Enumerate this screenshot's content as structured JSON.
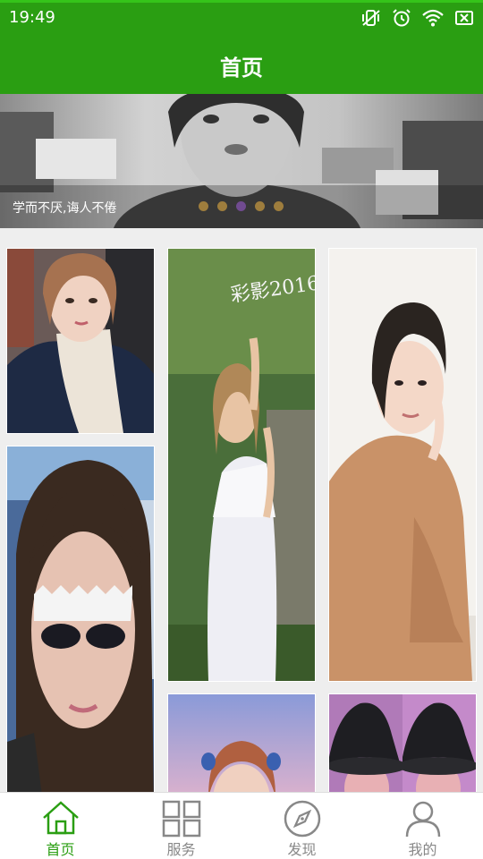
{
  "status_bar": {
    "time": "19:49",
    "icons": [
      "vibrate-off-icon",
      "alarm-icon",
      "wifi-icon",
      "no-sim-icon"
    ]
  },
  "app_bar": {
    "title": "首页"
  },
  "banner": {
    "caption": "学而不厌,诲人不倦",
    "page_count": 5,
    "active_index": 2
  },
  "grid": {
    "images": [
      {
        "description": "photo-girl-scarf"
      },
      {
        "description": "photo-girl-sunglasses"
      },
      {
        "description": "photo-girl-white-dress"
      },
      {
        "description": "photo-girl-pigtails"
      },
      {
        "description": "photo-woman-sweater"
      },
      {
        "description": "photo-woman-hat"
      }
    ],
    "overlay_text": "彩影2016"
  },
  "tabs": [
    {
      "label": "首页",
      "icon": "home-icon",
      "active": true
    },
    {
      "label": "服务",
      "icon": "grid-icon",
      "active": false
    },
    {
      "label": "发现",
      "icon": "compass-icon",
      "active": false
    },
    {
      "label": "我的",
      "icon": "user-icon",
      "active": false
    }
  ],
  "colors": {
    "primary": "#2a9e12",
    "tab_inactive": "#888888",
    "background": "#eeeeee"
  }
}
